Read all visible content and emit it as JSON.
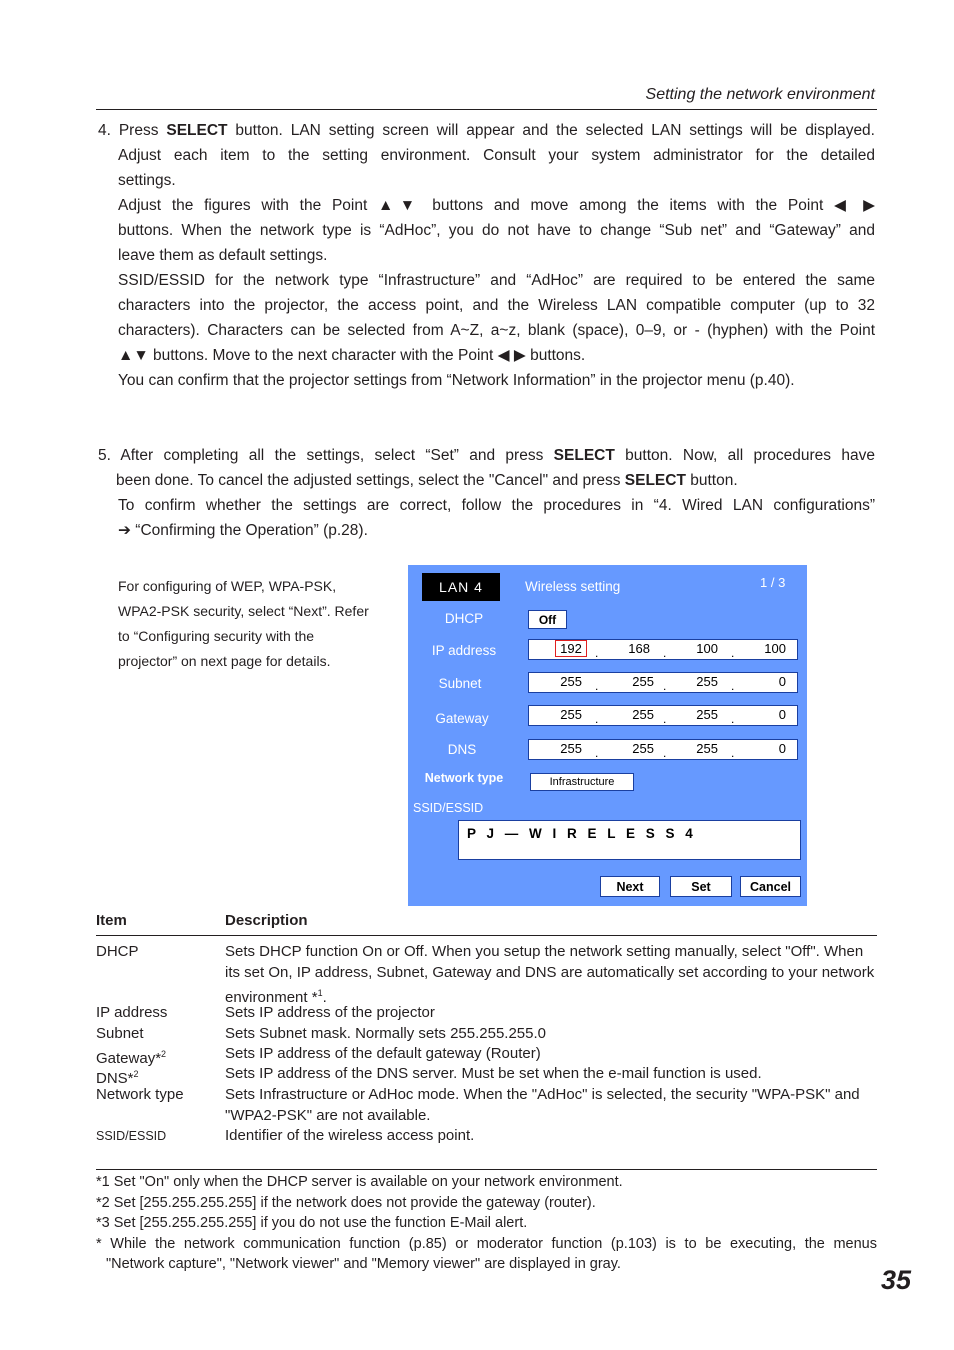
{
  "header": {
    "section_title": "Setting  the network environment"
  },
  "step4": {
    "lines": [
      {
        "pre": "4. Press ",
        "bold": "SELECT",
        "post": " button. LAN setting screen will appear and the selected LAN settings will be displayed."
      },
      {
        "text": "Adjust each item to the setting environment. Consult your system administrator for the detailed"
      },
      {
        "text": "settings."
      },
      {
        "text": "Adjust the figures with the Point ▲▼ buttons and move among the items with the Point ◀ ▶"
      },
      {
        "text": "buttons. When the network type is “AdHoc”, you do not have to change “Sub net” and “Gateway” and"
      },
      {
        "text": "leave them as default settings."
      },
      {
        "text": "SSID/ESSID for the network type “Infrastructure” and “AdHoc” are required to be entered the same"
      },
      {
        "text": "characters into the projector, the access point, and the Wireless LAN compatible computer (up to 32"
      },
      {
        "text": "characters). Characters can be selected from A~Z, a~z, blank (space), 0–9, or - (hyphen) with the Point"
      },
      {
        "text": "▲▼ buttons. Move to the next character with the Point ◀ ▶ buttons."
      },
      {
        "text": "You can confirm that the projector settings from “Network Information” in the projector menu (p.40)."
      }
    ]
  },
  "step5": {
    "line1_pre": "5. After completing all the settings, select “Set” and press ",
    "line1_bold": "SELECT",
    "line1_post": " button. Now, all procedures have",
    "line2_pre": "been done. To cancel the adjusted settings, select the \"Cancel\" and press ",
    "line2_bold": "SELECT",
    "line2_post": " button.",
    "line3": "To confirm whether the settings are correct, follow the procedures in “4. Wired LAN configurations”",
    "line4": "➔ “Confirming the Operation” (p.28)."
  },
  "note": {
    "lines": [
      "For configuring of WEP, WPA-PSK,",
      "WPA2-PSK security, select “Next”. Refer",
      "to  “Configuring security with the",
      "projector” on next page for details."
    ]
  },
  "osd": {
    "lan_badge": "LAN 4",
    "title": "Wireless setting",
    "page": "1 / 3",
    "dhcp_label": "DHCP",
    "dhcp_value": "Off",
    "ip_label": "IP address",
    "ip": [
      "192",
      "168",
      "100",
      "100"
    ],
    "subnet_label": "Subnet",
    "subnet": [
      "255",
      "255",
      "255",
      "0"
    ],
    "gateway_label": "Gateway",
    "gateway": [
      "255",
      "255",
      "255",
      "0"
    ],
    "dns_label": "DNS",
    "dns": [
      "255",
      "255",
      "255",
      "0"
    ],
    "network_type_label": "Network type",
    "network_type_value": "Infrastructure",
    "ssid_label": "SSID/ESSID",
    "ssid_value": "P J — W I R E L E S S 4",
    "buttons": {
      "next": "Next",
      "set": "Set",
      "cancel": "Cancel"
    },
    "colors": {
      "background": "#6699ff",
      "selected_outline": "#e02020"
    }
  },
  "table": {
    "headers": {
      "item": "Item",
      "description": "Description"
    },
    "rows": [
      {
        "item": "DHCP",
        "sup": "",
        "desc": "Sets DHCP function On or Off. When you setup the network setting manually, select \"Off\". When its set On, IP address, Subnet, Gateway and DNS are automatically set according to your network environment *",
        "desc_sup": "1",
        "desc_end": "."
      },
      {
        "item": "IP address",
        "sup": "",
        "desc": "Sets IP address of the projector"
      },
      {
        "item": "Subnet",
        "sup": "",
        "desc": "Sets Subnet mask. Normally sets 255.255.255.0"
      },
      {
        "item": "Gateway*",
        "sup": "2",
        "desc": "Sets IP address of the default gateway (Router)"
      },
      {
        "item": "DNS*",
        "sup": "2",
        "desc": "Sets IP address of the DNS server. Must be set when the e-mail function is used."
      },
      {
        "item": "Network type",
        "sup": "",
        "desc": "Sets Infrastructure or AdHoc mode. When the \"AdHoc\" is selected, the security \"WPA-PSK\" and \"WPA2-PSK\" are not available."
      },
      {
        "item": "SSID/ESSID",
        "sup": "",
        "desc": "Identifier of the wireless access point."
      }
    ]
  },
  "footnotes": [
    "*1 Set \"On\" only when the DHCP server is available on your network environment.",
    "*2 Set [255.255.255.255] if the network does not provide the gateway (router).",
    "*3 Set [255.255.255.255] if you do not use the function E-Mail alert.",
    "* While the network communication function (p.85) or moderator function (p.103) is to be executing, the menus",
    "\"Network capture\", \"Network viewer\" and \"Memory viewer\" are displayed in gray."
  ],
  "page_number": "35"
}
